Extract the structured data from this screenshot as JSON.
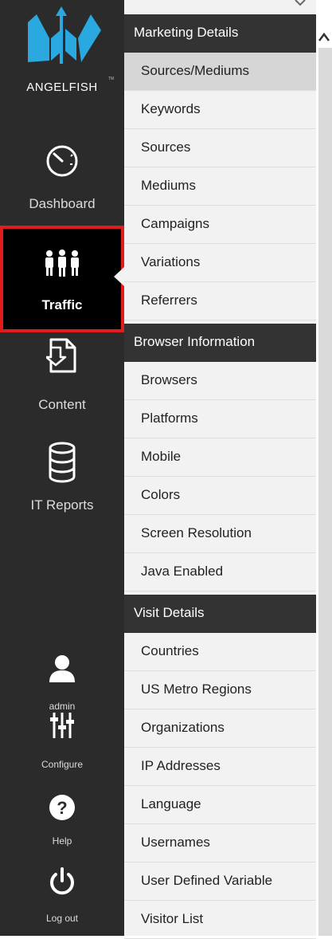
{
  "brand": {
    "name": "ANGELFISH",
    "tm": "TM"
  },
  "nav": {
    "dashboard": "Dashboard",
    "traffic": "Traffic",
    "content": "Content",
    "it_reports": "IT Reports",
    "admin": "admin",
    "configure": "Configure",
    "help": "Help",
    "logout": "Log out"
  },
  "menu": {
    "marketing_header": "Marketing Details",
    "marketing_items": [
      "Sources/Mediums",
      "Keywords",
      "Sources",
      "Mediums",
      "Campaigns",
      "Variations",
      "Referrers"
    ],
    "browser_header": "Browser Information",
    "browser_items": [
      "Browsers",
      "Platforms",
      "Mobile",
      "Colors",
      "Screen Resolution",
      "Java Enabled"
    ],
    "visit_header": "Visit Details",
    "visit_items": [
      "Countries",
      "US Metro Regions",
      "Organizations",
      "IP Addresses",
      "Language",
      "Usernames",
      "User Defined Variable",
      "Visitor List"
    ]
  },
  "colors": {
    "accent_blue": "#2aa9e0",
    "active_outline": "#e21b1b",
    "sidebar_bg": "#2b2b2b"
  },
  "icons": {
    "dashboard": "speedometer-icon",
    "traffic": "people-icon",
    "content": "document-icon",
    "it_reports": "database-icon",
    "admin": "user-icon",
    "configure": "sliders-icon",
    "help": "help-icon",
    "logout": "power-icon"
  }
}
